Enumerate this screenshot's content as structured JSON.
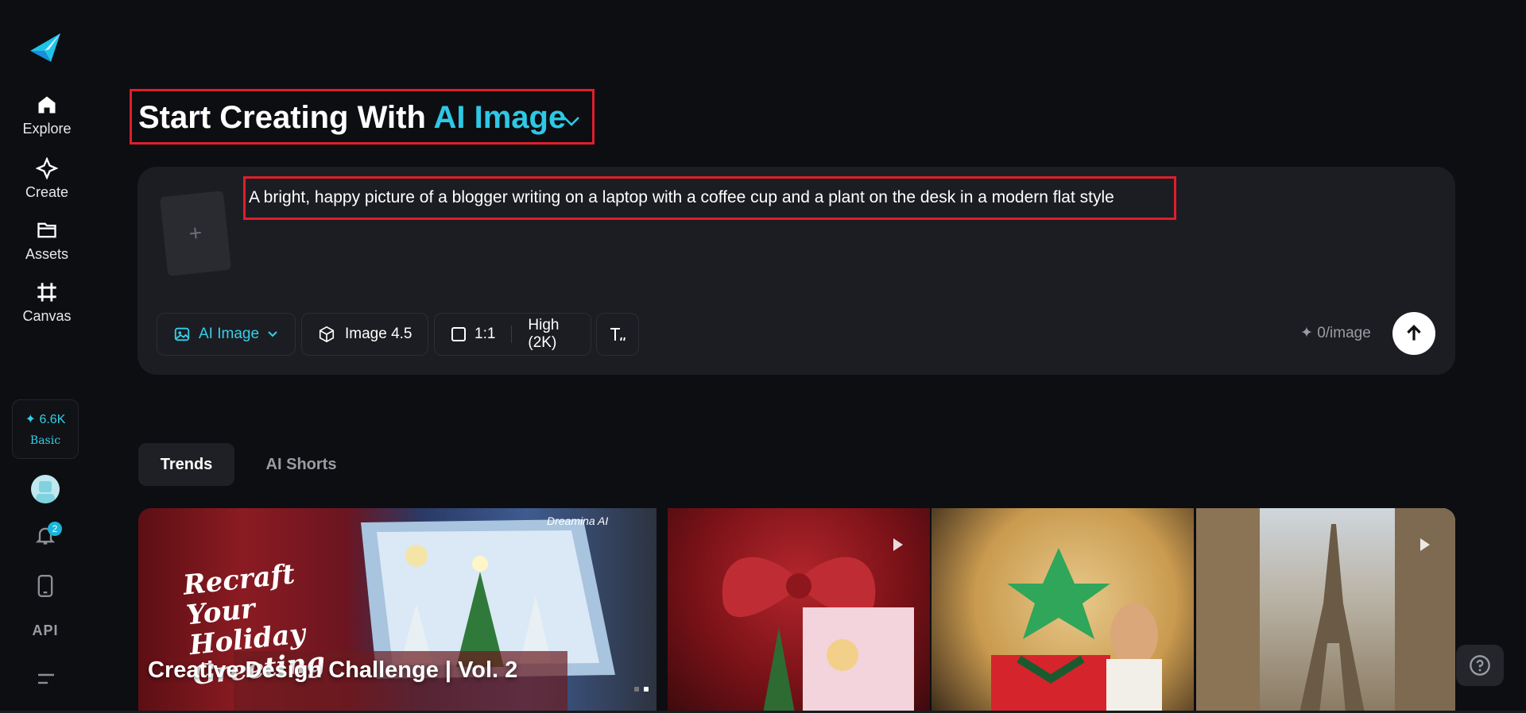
{
  "sidebar": {
    "items": [
      {
        "label": "Explore",
        "icon": "home-icon"
      },
      {
        "label": "Create",
        "icon": "sparkle-icon"
      },
      {
        "label": "Assets",
        "icon": "folder-icon"
      },
      {
        "label": "Canvas",
        "icon": "crop-icon"
      }
    ],
    "credits": {
      "amount": "✦ 6.6K",
      "plan": "Basic"
    },
    "notifications_count": "2",
    "api_label": "API"
  },
  "heading": {
    "prefix": "Start Creating With",
    "accent": "AI Image"
  },
  "prompt": {
    "text": "A bright, happy picture of a blogger writing on a laptop with a coffee cup and a plant on the desk in a modern flat style",
    "upload_glyph": "+"
  },
  "toolbar": {
    "mode_label": "AI Image",
    "model_label": "Image 4.5",
    "ratio_label": "1:1",
    "quality_label": "High (2K)",
    "cost_label": "✦ 0/image"
  },
  "tabs": [
    {
      "label": "Trends",
      "active": true
    },
    {
      "label": "AI Shorts",
      "active": false
    }
  ],
  "gallery": {
    "featured_title": "Creative Design Challenge | Vol. 2",
    "featured_script": "Recraft Your Holiday Greeting",
    "brand_tag": "Dreamina AI"
  },
  "colors": {
    "accent": "#2ec8e6",
    "highlight_border": "#e01e2b",
    "background": "#0d0e11",
    "card": "#1c1d22"
  }
}
